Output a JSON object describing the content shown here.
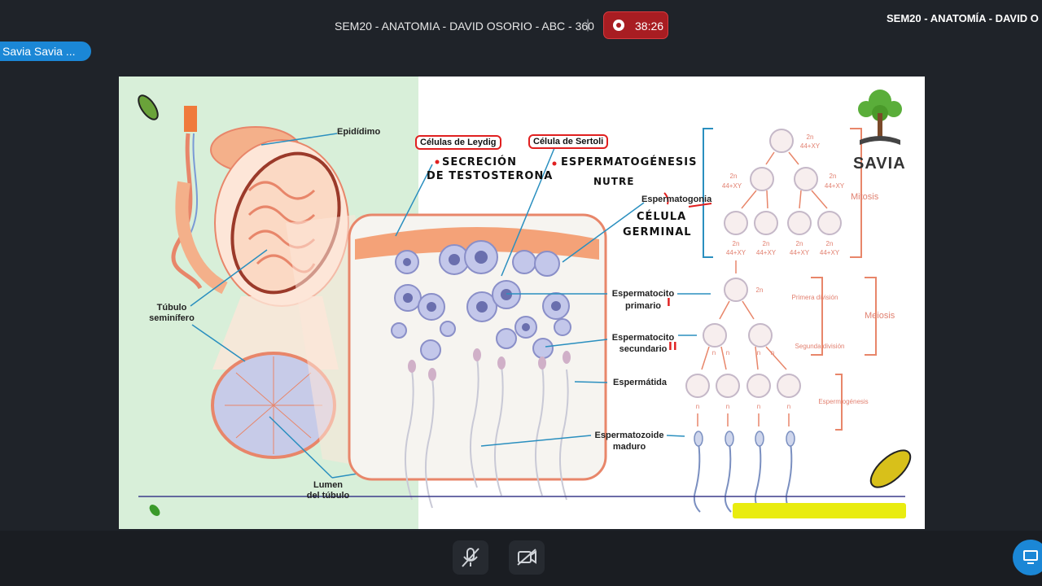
{
  "meeting": {
    "title": "SEM20 - ANATOMIA - DAVID OSORIO - ABC - 360",
    "separator": "|",
    "timer": "38:26",
    "right_title": "SEM20 - ANATOMÍA - DAVID O",
    "speaker": "Savia Savia ..."
  },
  "slide": {
    "labels": {
      "epididimo": "Epidídimo",
      "tubulo_1": "Túbulo",
      "tubulo_2": "seminífero",
      "lumen_1": "Lumen",
      "lumen_2": "del túbulo",
      "leydig": "Células de Leydig",
      "sertoli": "Célula de Sertoli",
      "espermatogonia": "Espermatogonia",
      "espermatocito_primario_1": "Espermatocito",
      "espermatocito_primario_2": "primario",
      "espermatocito_secundario_1": "Espermatocito",
      "espermatocito_secundario_2": "secundario",
      "espermatida": "Espermátida",
      "espermatozoide_1": "Espermatozoide",
      "espermatozoide_2": "maduro"
    },
    "handwriting": {
      "secrecion_1": "SECRECIÓN",
      "secrecion_2": "DE TESTOSTERONA",
      "espermatogenesis": "ESPERMATOGÉNESIS",
      "nutre": "NUTRE",
      "celula_1": "CÉLULA",
      "celula_2": "GERMINAL",
      "roman_one": "I",
      "roman_two": "II"
    },
    "diagram": {
      "ploidy_2n": "2n",
      "karyotype": "44+XY",
      "ploidy_n": "n",
      "mitosis": "Mitosis",
      "meiosis": "Meiosis",
      "primera_division": "Primera división",
      "segunda_division": "Segunda división",
      "espermiogenesis": "Espermiogénesis"
    },
    "logo": {
      "text": "SAVIA"
    }
  },
  "colors": {
    "background": "#1f2329",
    "record": "#a81d22",
    "accent_blue": "#1b87d6",
    "slide_green": "#d8efd9",
    "highlight_yellow": "#e9ec10",
    "tissue_orange": "#e8866a",
    "cell_purple": "#8a8fc8"
  },
  "icons": {
    "mic": "mic-off-icon",
    "camera": "camera-off-icon",
    "share": "share-screen-icon",
    "record": "record-icon"
  }
}
